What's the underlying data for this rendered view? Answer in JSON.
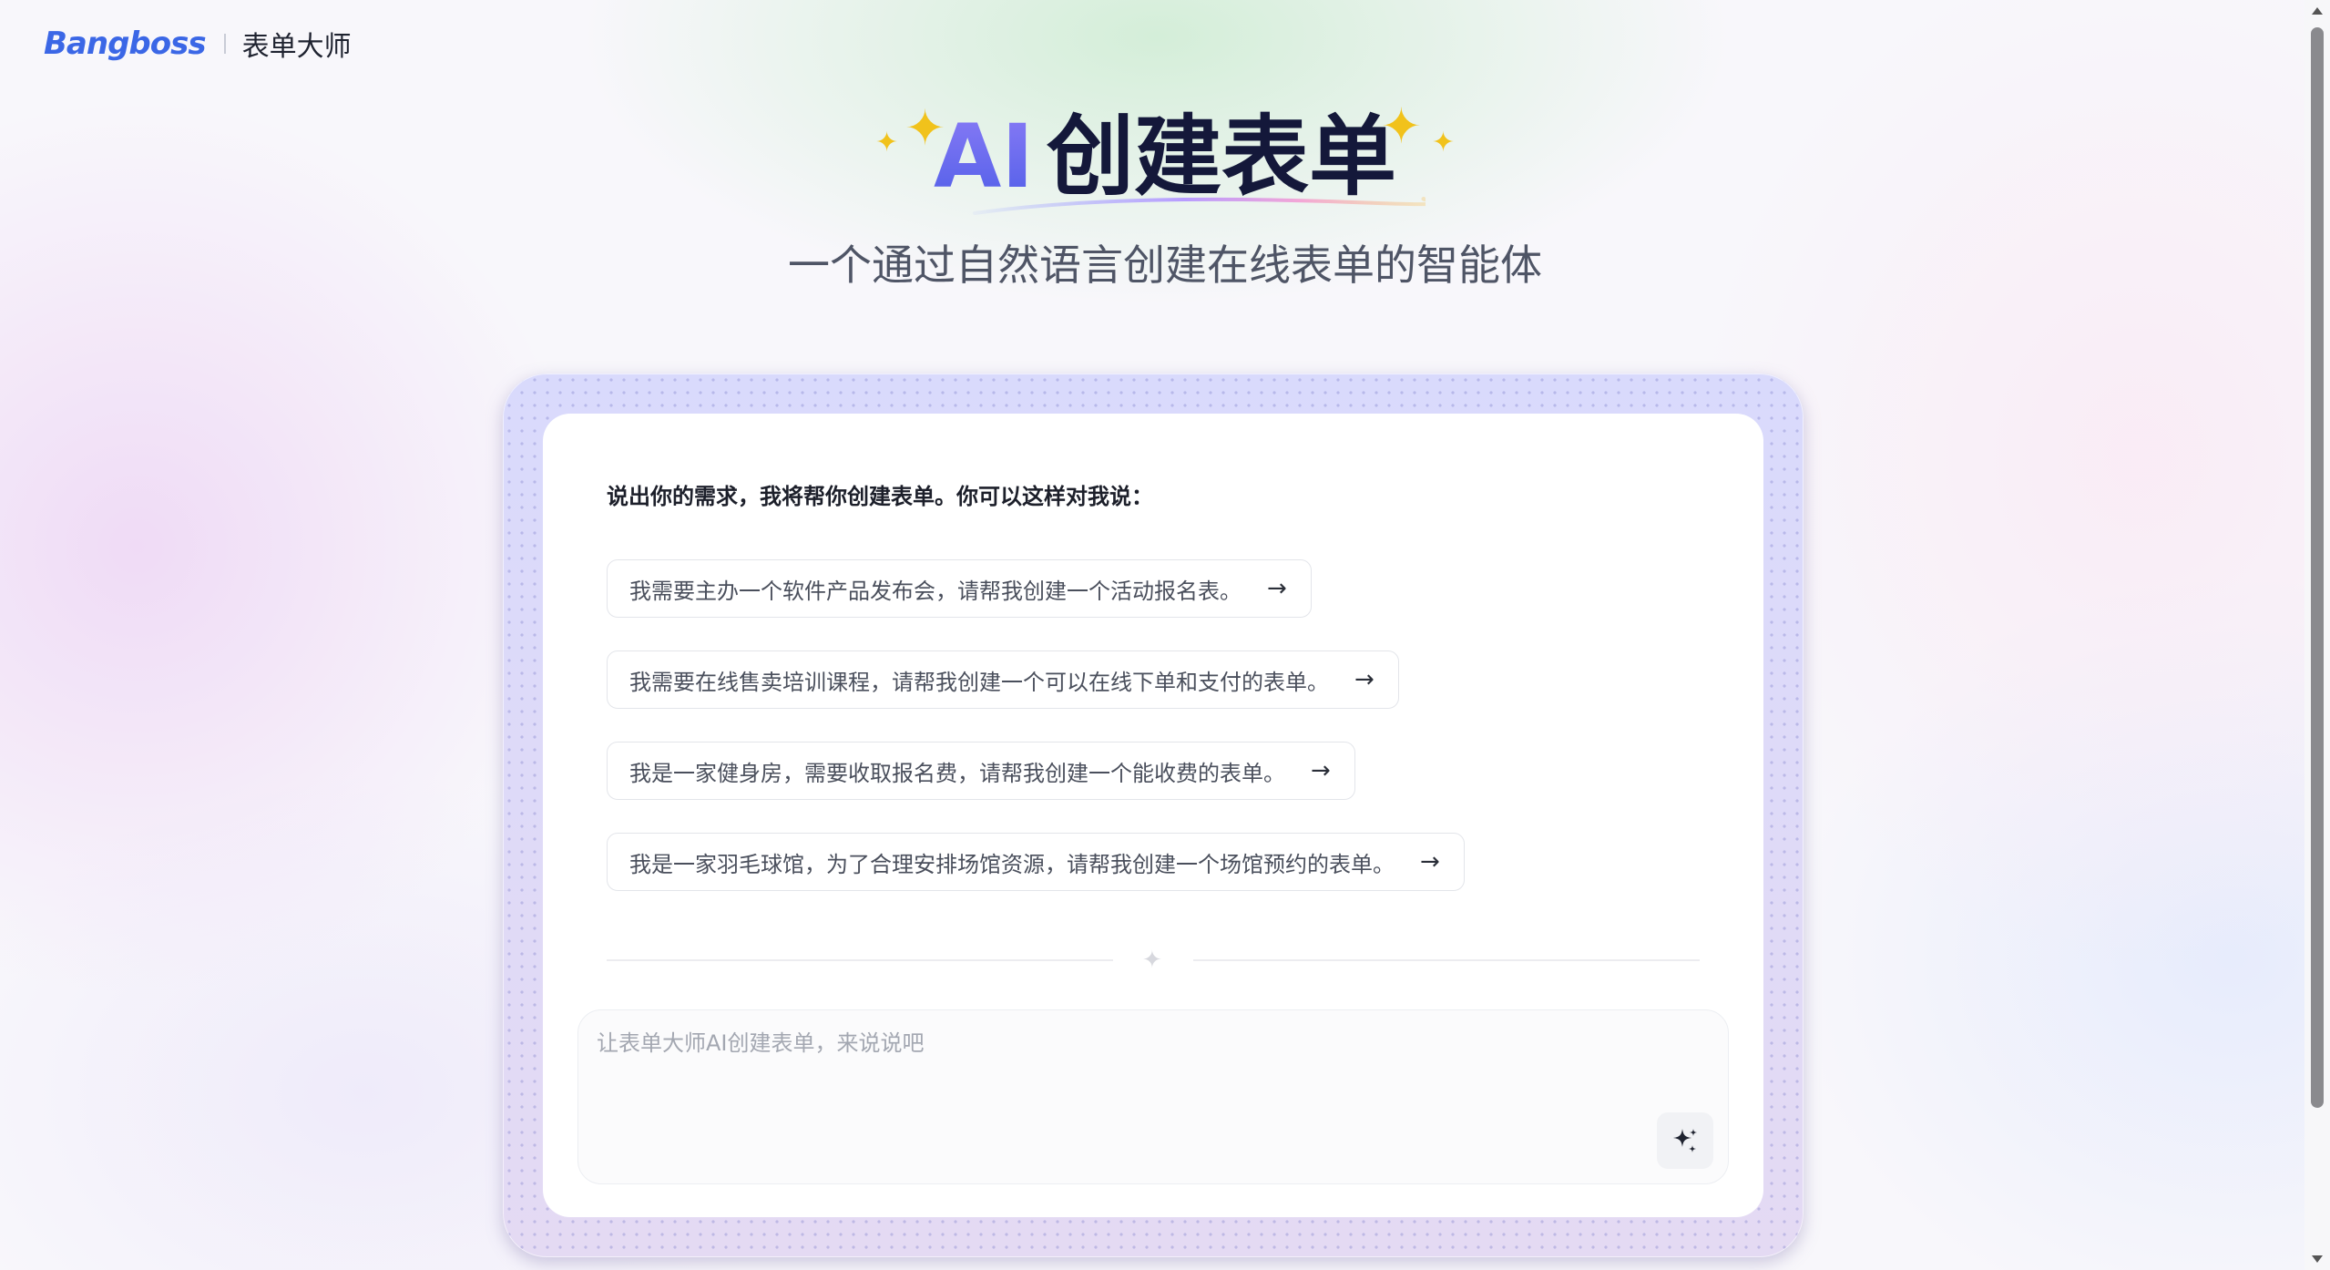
{
  "header": {
    "brand": "Bangboss",
    "product": "表单大师"
  },
  "hero": {
    "title_ai": "AI",
    "title_rest": "创建表单",
    "subtitle": "一个通过自然语言创建在线表单的智能体"
  },
  "card": {
    "heading": "说出你的需求，我将帮你创建表单。你可以这样对我说：",
    "suggestions": [
      {
        "text": "我需要主办一个软件产品发布会，请帮我创建一个活动报名表。",
        "arrow": "→"
      },
      {
        "text": "我需要在线售卖培训课程，请帮我创建一个可以在线下单和支付的表单。",
        "arrow": "→"
      },
      {
        "text": "我是一家健身房，需要收取报名费，请帮我创建一个能收费的表单。",
        "arrow": "→"
      },
      {
        "text": "我是一家羽毛球馆，为了合理安排场馆资源，请帮我创建一个场馆预约的表单。",
        "arrow": "→"
      }
    ],
    "input": {
      "placeholder": "让表单大师AI创建表单，来说说吧",
      "value": ""
    }
  },
  "icons": {
    "sparkle": "sparkle-icon",
    "send": "ai-sparkles-icon",
    "arrow": "arrow-right-icon"
  },
  "colors": {
    "brand": "#3b67e6",
    "ai_gradient_start": "#8b7cf6",
    "ai_gradient_end": "#4f5ee8",
    "sparkle": "#f1c21b",
    "card_frame": "#dcdcfa"
  }
}
